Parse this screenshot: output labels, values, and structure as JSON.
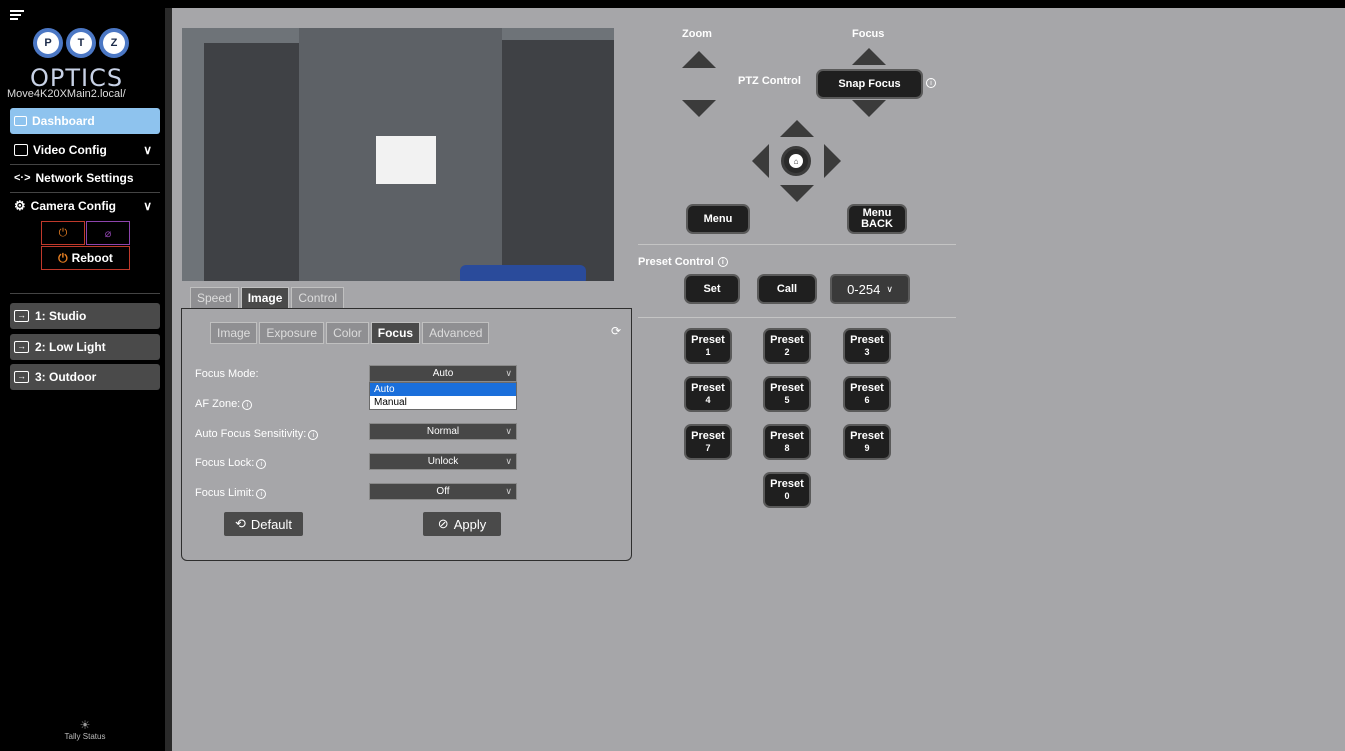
{
  "sidebar": {
    "logo_letters": [
      "P",
      "T",
      "Z"
    ],
    "logo_text": "OPTICS",
    "device_name": "Move4K20XMain2.local/",
    "nav": [
      {
        "label": "Dashboard",
        "active": true
      },
      {
        "label": "Video Config",
        "expandable": true
      },
      {
        "label": "Network Settings"
      },
      {
        "label": "Camera Config",
        "expandable": true
      }
    ],
    "power_icon": "power-icon",
    "hide_icon": "eye-off-icon",
    "reboot_label": "Reboot",
    "presets": [
      {
        "label": "1: Studio"
      },
      {
        "label": "2: Low Light"
      },
      {
        "label": "3: Outdoor"
      }
    ],
    "tally_label": "Tally Status"
  },
  "camera": {
    "main_tabs": [
      "Speed",
      "Image",
      "Control"
    ],
    "active_main_tab": "Image",
    "sub_tabs": [
      "Image",
      "Exposure",
      "Color",
      "Focus",
      "Advanced"
    ],
    "active_sub_tab": "Focus",
    "fields": [
      {
        "label": "Focus Mode:",
        "value": "Auto",
        "info": false
      },
      {
        "label": "AF Zone:",
        "value": "",
        "info": true
      },
      {
        "label": "Auto Focus Sensitivity:",
        "value": "Normal",
        "info": true
      },
      {
        "label": "Focus Lock:",
        "value": "Unlock",
        "info": true
      },
      {
        "label": "Focus Limit:",
        "value": "Off",
        "info": true
      }
    ],
    "focus_mode_options": [
      "Auto",
      "Manual"
    ],
    "focus_mode_selected": "Auto",
    "default_label": "Default",
    "apply_label": "Apply"
  },
  "ptz": {
    "zoom_label": "Zoom",
    "focus_label": "Focus",
    "ptz_control_label": "PTZ Control",
    "snap_focus_label": "Snap Focus",
    "menu_label": "Menu",
    "menu_back_line1": "Menu",
    "menu_back_line2": "BACK",
    "preset_control_label": "Preset Control",
    "set_label": "Set",
    "call_label": "Call",
    "preset_range": "0-254",
    "preset_word": "Preset",
    "preset_numbers": [
      "1",
      "2",
      "3",
      "4",
      "5",
      "6",
      "7",
      "8",
      "9",
      "0"
    ]
  },
  "colors": {
    "accent": "#8ec3ee",
    "main_bg": "#a6a6a9",
    "danger": "#c0392b"
  }
}
